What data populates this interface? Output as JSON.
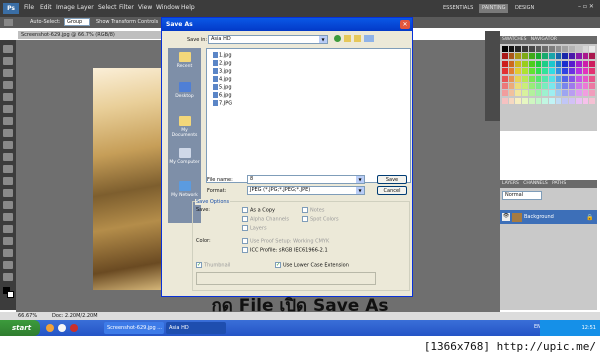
{
  "photoshop": {
    "logo": "Ps",
    "menu": [
      "File",
      "Edit",
      "Image",
      "Layer",
      "Select",
      "Filter",
      "View",
      "Window",
      "Help"
    ],
    "workspaces": [
      "ESSENTIALS",
      "PAINTING",
      "DESIGN"
    ],
    "options_bar": {
      "auto_select_label": "Auto-Select:",
      "auto_select_value": "Group",
      "transform_label": "Show Transform Controls"
    },
    "doc_tab": "Screenshot-629.jpg @ 66.7% (RGB/8)",
    "status": {
      "zoom": "66.67%",
      "doc": "Doc: 2.20M/2.20M"
    },
    "swatches_tabs": [
      "SWATCHES",
      "NAVIGATOR"
    ],
    "layers_tabs": [
      "LAYERS",
      "CHANNELS",
      "PATHS"
    ],
    "layer_blend": "Normal",
    "layer_name": "Background"
  },
  "dialog": {
    "title": "Save As",
    "save_in_label": "Save in:",
    "save_in_value": "Asia HD",
    "places": [
      "Recent",
      "Desktop",
      "My Documents",
      "My Computer",
      "My Network"
    ],
    "files": [
      "1.jpg",
      "2.jpg",
      "3.jpg",
      "4.jpg",
      "5.jpg",
      "6.jpg",
      "7.JPG"
    ],
    "file_name_label": "File name:",
    "file_name_value": "8",
    "format_label": "Format:",
    "format_value": "JPEG (*.JPG;*.JPEG;*.JPE)",
    "save_button": "Save",
    "cancel_button": "Cancel",
    "save_options_title": "Save Options",
    "save_label": "Save:",
    "as_copy": "As a Copy",
    "notes": "Notes",
    "alpha_channels": "Alpha Channels",
    "spot_colors": "Spot Colors",
    "layers": "Layers",
    "color_label": "Color:",
    "use_proof": "Use Proof Setup: Working CMYK",
    "icc_label": "ICC Profile: sRGB IEC61966-2.1",
    "thumbnail": "Thumbnail",
    "lowercase_ext": "Use Lower Case Extension"
  },
  "caption": "กด File เปิด Save As",
  "taskbar": {
    "start": "start",
    "tasks": [
      "Screenshot-629.jpg ...",
      "Asia HD"
    ],
    "lang": "EN",
    "clock": "12:51"
  },
  "watermark": "[1366x768] http://upic.me/"
}
